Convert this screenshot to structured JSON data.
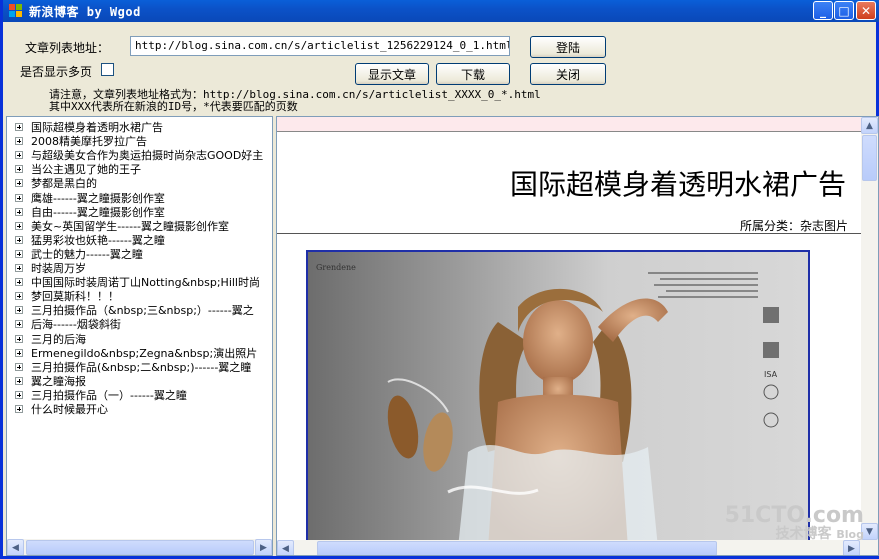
{
  "window": {
    "title": "新浪博客 by Wgod",
    "controls": {
      "minimize": "_",
      "maximize": "□",
      "close": "✕"
    }
  },
  "form": {
    "url_label": "文章列表地址：",
    "url_value": "http://blog.sina.com.cn/s/articlelist_1256229124_0_1.html",
    "multipage_label": "是否显示多页",
    "multipage_checked": false,
    "login_button": "登陆",
    "show_button": "显示文章",
    "download_button": "下载",
    "close_button": "关闭",
    "note_line1": "请注意，文章列表地址格式为：http://blog.sina.com.cn/s/articlelist_XXXX_0_*.html",
    "note_line2": "其中XXX代表所在新浪的ID号，*代表要匹配的页数"
  },
  "tree": {
    "items": [
      "国际超模身着透明水裙广告",
      "2008精美摩托罗拉广告",
      "与超级美女合作为奥运拍摄时尚杂志GOOD好主",
      "当公主遇见了她的王子",
      "梦都是黑白的",
      "鹰雄------翼之瞳摄影创作室",
      "自由------翼之瞳摄影创作室",
      "美女~英国留学生------翼之瞳摄影创作室",
      "猛男彩妆也妖艳------翼之瞳",
      "武士的魅力------翼之瞳",
      "时装周万岁",
      "中国国际时装周诺丁山Notting&nbsp;Hill时尚",
      "梦回莫斯科！！！",
      "三月拍摄作品（&nbsp;三&nbsp;）------翼之",
      "后海------烟袋斜街",
      "三月的后海",
      "Ermenegildo&nbsp;Zegna&nbsp;演出照片",
      "三月拍摄作品(&nbsp;二&nbsp;)------翼之瞳",
      "翼之瞳海报",
      "三月拍摄作品（一）------翼之瞳",
      "什么时候最开心"
    ]
  },
  "article": {
    "title": "国际超模身着透明水裙广告",
    "category": "所属分类：杂志图片",
    "photo_brand": "Grendene",
    "photo_badges": [
      "ISA"
    ]
  },
  "watermark": {
    "site": "51CTO.com",
    "line2": "技术博客",
    "line3": "Blog"
  },
  "colors": {
    "titlebar": "#0b52c8",
    "window_bg": "#ece9d8",
    "photo_border": "#1f2fa8",
    "pink_bar": "#fde9ec"
  }
}
